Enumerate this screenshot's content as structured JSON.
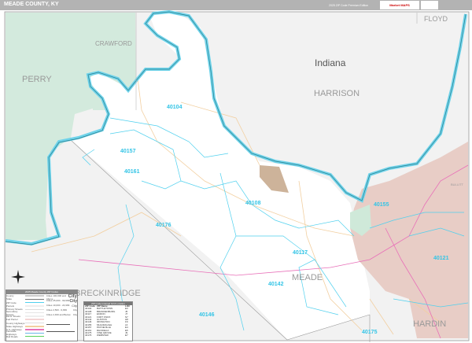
{
  "header": {
    "title": "MEADE COUNTY, KY",
    "edition": "2025 ZIP Code Premium Edition",
    "logo": "Market MAPS"
  },
  "colors": {
    "river": "#6fd3ea",
    "river_edge": "#2a7f8e",
    "zip_boundary": "#4fd0ee",
    "forest": "#d3eadd",
    "military": "#e8cdc6",
    "city": "#cdb39a",
    "highway": "#e86fb8",
    "road": "#f2cfa0"
  },
  "map": {
    "states": {
      "indiana": "Indiana"
    },
    "counties": {
      "perry": "PERRY",
      "crawford": "CRAWFORD",
      "harrison": "HARRISON",
      "floyd": "FLOYD",
      "breckinridge": "BRECKINRIDGE",
      "meade": "MEADE",
      "hardin": "HARDIN",
      "bullitt": "BULLITT"
    },
    "zip_labels": [
      "40104",
      "40157",
      "40161",
      "40176",
      "40108",
      "40117",
      "40142",
      "40146",
      "40155",
      "40121",
      "40175"
    ]
  },
  "legend": {
    "title": "2025 Meade County ZIP Codes",
    "items": [
      "County",
      "State",
      "ZIP Code",
      "Parcels",
      "Primary Streets",
      "Secondary Streets",
      "Minor Streets",
      "Fed Parcel",
      "County Highways",
      "State Highways",
      "U.S. Highways",
      "Interstate Highways",
      "Rail Roads"
    ],
    "city_sizes": [
      {
        "label": "Cities 100,000 and Above",
        "sample": "City"
      },
      {
        "label": "Cities 25,000 - 99,999",
        "sample": "City"
      },
      {
        "label": "Cities 10,000 - 24,999",
        "sample": "City"
      },
      {
        "label": "Cities 2,500 - 9,999",
        "sample": "City"
      },
      {
        "label": "Cities 2,499 and Below",
        "sample": "City"
      }
    ]
  },
  "zip_table": {
    "title": "ZIP Code Indexed Grid Location",
    "headers": [
      "ZIP Code",
      "ZIP Name",
      "LOC"
    ],
    "rows": [
      [
        "40104",
        "BATTLETOWN",
        "E3"
      ],
      [
        "40108",
        "BRANDENBURG",
        "J5"
      ],
      [
        "40117",
        "EKRON",
        "J7"
      ],
      [
        "40121",
        "FORT KNOX",
        "N7"
      ],
      [
        "40142",
        "GUSTON",
        "H8"
      ],
      [
        "40146",
        "IRVINGTON",
        "F9"
      ],
      [
        "40155",
        "MULDRAUGH",
        "L6"
      ],
      [
        "40157",
        "PAYNEVILLE",
        "E4"
      ],
      [
        "40161",
        "RHODELIA",
        "E5"
      ],
      [
        "40175",
        "VINE GROVE",
        "J9"
      ],
      [
        "40176",
        "WEBSTER",
        "E7"
      ]
    ]
  }
}
